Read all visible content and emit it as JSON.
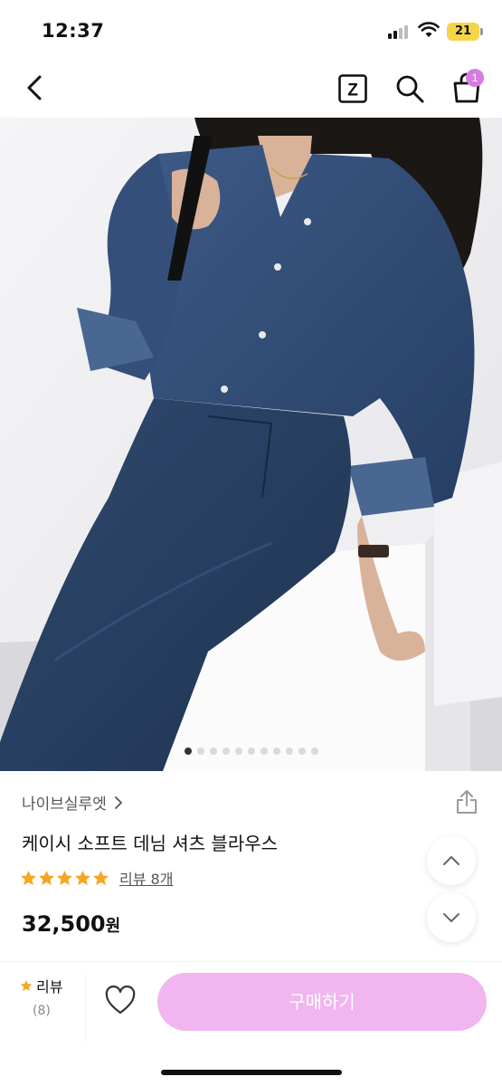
{
  "status_bar": {
    "time": "12:37",
    "battery": "21"
  },
  "nav": {
    "back_icon": "chevron-left-icon",
    "z_icon": "z-box-icon",
    "z_label": "Z",
    "search_icon": "search-icon",
    "cart_icon": "shopping-bag-icon",
    "cart_badge": "1",
    "badge_color": "#d67be0"
  },
  "product_image": {
    "slide_count": 11,
    "active_index": 0
  },
  "product": {
    "brand": "나이브실루엣",
    "title": "케이시 소프트 데님 셔츠 블라우스",
    "rating_stars": 5,
    "review_link": "리뷰 8개",
    "price": "32,500",
    "price_unit": "원",
    "star_color": "#f5a623"
  },
  "bottom_bar": {
    "review_label": "리뷰",
    "review_count": "(8)",
    "buy_label": "구매하기",
    "buy_color": "#f1b5ef"
  }
}
